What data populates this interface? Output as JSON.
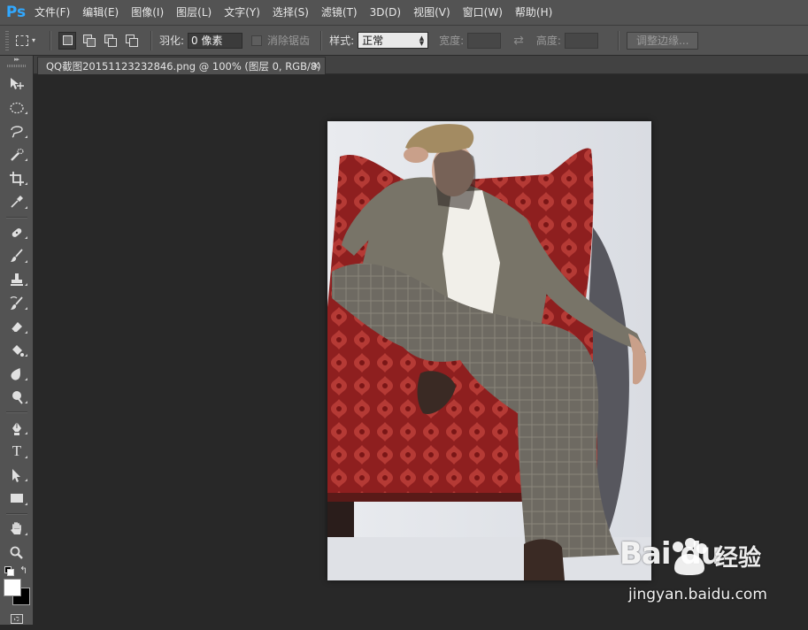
{
  "app": {
    "logo_text": "Ps"
  },
  "menu": {
    "items": [
      {
        "label": "文件(F)"
      },
      {
        "label": "编辑(E)"
      },
      {
        "label": "图像(I)"
      },
      {
        "label": "图层(L)"
      },
      {
        "label": "文字(Y)"
      },
      {
        "label": "选择(S)"
      },
      {
        "label": "滤镜(T)"
      },
      {
        "label": "3D(D)"
      },
      {
        "label": "视图(V)"
      },
      {
        "label": "窗口(W)"
      },
      {
        "label": "帮助(H)"
      }
    ]
  },
  "options": {
    "feather_label": "羽化:",
    "feather_value": "0 像素",
    "antialias_label": "消除锯齿",
    "antialias_checked": false,
    "style_label": "样式:",
    "style_value": "正常",
    "width_label": "宽度:",
    "width_value": "",
    "height_label": "高度:",
    "height_value": "",
    "refine_edge_label": "调整边缘..."
  },
  "tools": {
    "collapse_glyph": "▸▸",
    "type_tool_glyph": "T",
    "items": [
      {
        "name": "move-tool-icon"
      },
      {
        "name": "elliptical-marquee-tool-icon"
      },
      {
        "name": "lasso-tool-icon"
      },
      {
        "name": "quick-selection-tool-icon"
      },
      {
        "name": "crop-tool-icon"
      },
      {
        "name": "eyedropper-tool-icon"
      },
      {
        "name": "spot-healing-brush-tool-icon"
      },
      {
        "name": "brush-tool-icon"
      },
      {
        "name": "clone-stamp-tool-icon"
      },
      {
        "name": "history-brush-tool-icon"
      },
      {
        "name": "eraser-tool-icon"
      },
      {
        "name": "paint-bucket-tool-icon"
      },
      {
        "name": "blur-tool-icon"
      },
      {
        "name": "dodge-tool-icon"
      },
      {
        "name": "pen-tool-icon"
      },
      {
        "name": "type-tool-icon"
      },
      {
        "name": "path-selection-tool-icon"
      },
      {
        "name": "rectangle-tool-icon"
      },
      {
        "name": "hand-tool-icon"
      },
      {
        "name": "zoom-tool-icon"
      }
    ],
    "foreground_color": "#ffffff",
    "background_color": "#000000"
  },
  "document": {
    "tab_title": "QQ截图20151123232846.png @ 100% (图层 0, RGB/8)",
    "close_glyph": "×"
  },
  "colors": {
    "chrome": "#535353",
    "canvas_bg": "#282828",
    "accent": "#31a8ff"
  },
  "watermark": {
    "logo_text": "Bai  du",
    "brand_text": "经验",
    "url_text": "jingyan.baidu.com"
  }
}
